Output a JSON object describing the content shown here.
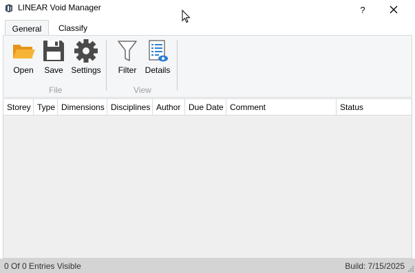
{
  "window": {
    "title": "LINEAR Void Manager",
    "help": "?",
    "app_icon": "linear-logo-icon",
    "close_icon": "close-icon"
  },
  "tabs": [
    {
      "label": "General",
      "active": true
    },
    {
      "label": "Classify",
      "active": false
    }
  ],
  "ribbon": {
    "groups": [
      {
        "label": "File",
        "buttons": [
          {
            "label": "Open",
            "icon": "folder-open-icon",
            "color": "#f2a81d"
          },
          {
            "label": "Save",
            "icon": "floppy-disk-icon",
            "color": "#4a4a4a"
          },
          {
            "label": "Settings",
            "icon": "gear-icon",
            "color": "#4a4a4a"
          }
        ]
      },
      {
        "label": "View",
        "buttons": [
          {
            "label": "Filter",
            "icon": "funnel-icon",
            "color": "#6f6f6f"
          },
          {
            "label": "Details",
            "icon": "details-list-eye-icon",
            "color": "#2d7fd1"
          }
        ]
      }
    ]
  },
  "grid": {
    "columns": [
      "Storey",
      "Type",
      "Dimensions",
      "Disciplines",
      "Author",
      "Due Date",
      "Comment",
      "Status"
    ],
    "rows": []
  },
  "status": {
    "entries": "0 Of 0 Entries Visible",
    "build": "Build: 7/15/2025"
  }
}
